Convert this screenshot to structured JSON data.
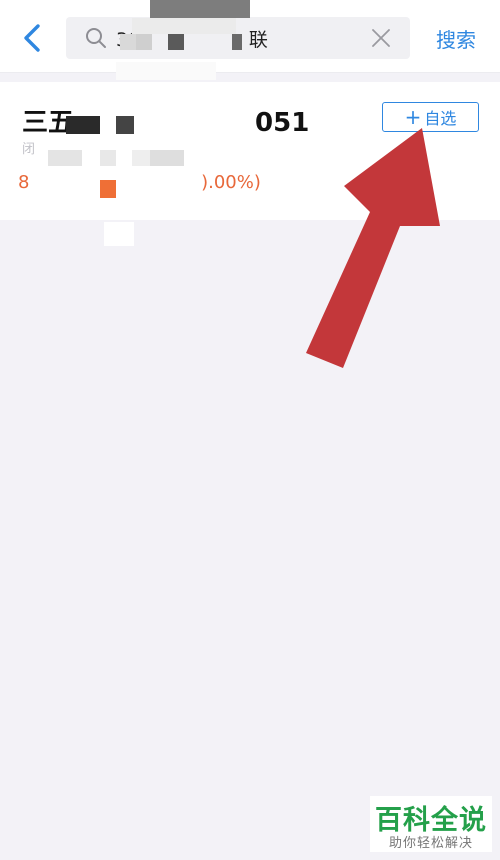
{
  "header": {
    "search_value": "30                  联",
    "search_button_label": "搜索"
  },
  "result": {
    "name": "三五                    051",
    "sub": "闭",
    "price": "8                              ).00%)",
    "add_button_label": "自选",
    "add_button_icon": "plus-icon"
  },
  "watermark": {
    "title": "百科全说",
    "subtitle": "助你轻松解决"
  },
  "colors": {
    "accent": "#2f87e0",
    "price_change": "#e8683a",
    "arrow": "#c3373a",
    "watermark_green": "#24a04a"
  },
  "icons": {
    "back": "chevron-left-icon",
    "search": "search-icon",
    "clear": "close-icon"
  }
}
